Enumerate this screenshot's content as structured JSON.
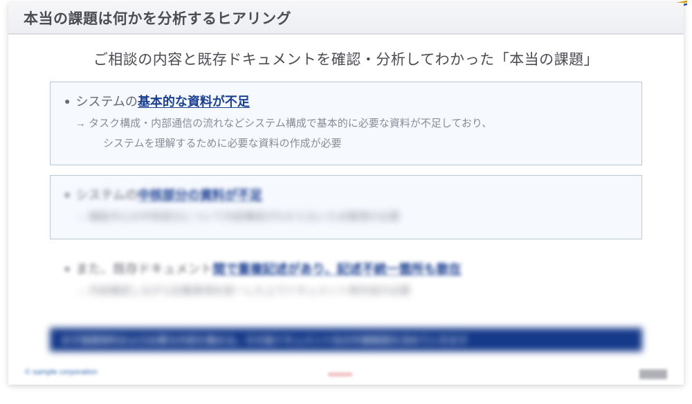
{
  "title": "本当の課題は何かを分析するヒアリング",
  "lead": "ご相談の内容と既存ドキュメントを確認・分析してわかった「本当の課題」",
  "cards": [
    {
      "prefix": "システムの",
      "emph": "基本的な資料が不足",
      "body_line1": "→ タスク構成・内部通信の流れなどシステム構成で基本的に必要な資料が不足しており、",
      "body_line2": "システムを理解するために必要な資料の作成が必要"
    },
    {
      "prefix": "システムの",
      "emph": "中核部分の資料が不足",
      "body_line1": "→ 機能中心の中核部分について内部構成がわからないため整理が必要",
      "body_line2": ""
    },
    {
      "prefix": "また、既存ドキュメント",
      "emph": "間で重複記述があり、記述不統一箇所も散在",
      "body_line1": "→ 内容確認しながら記載事項を統一した上でドキュメント再作成が必要",
      "body_line2": ""
    }
  ],
  "banner_text": "まず基礎資料および必要な内容を集める。その後ドキュメント化の作業範囲を決めていきます",
  "footer_left": "© sample corporation"
}
